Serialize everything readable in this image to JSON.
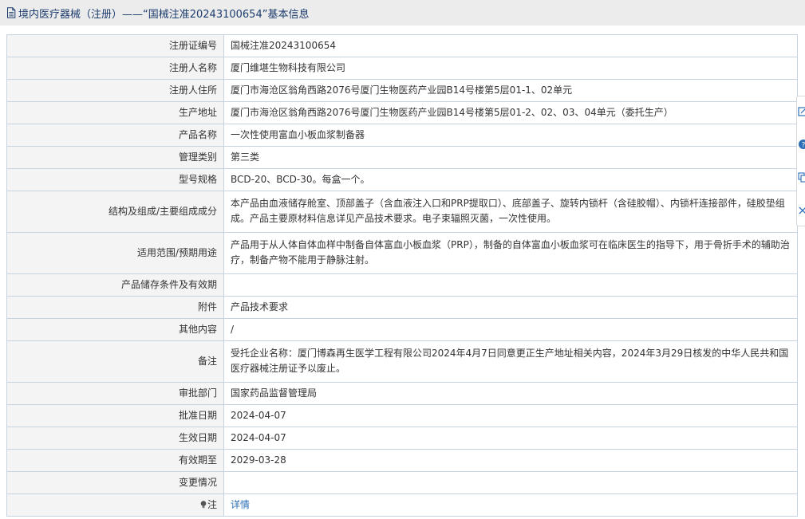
{
  "header": {
    "title": "境内医疗器械（注册）——“国械注准20243100654”基本信息",
    "icon": "document-icon",
    "color": "#1b3c6e"
  },
  "rows": [
    {
      "label": "注册证编号",
      "value": "国械注准20243100654"
    },
    {
      "label": "注册人名称",
      "value": "厦门维堪生物科技有限公司"
    },
    {
      "label": "注册人住所",
      "value": "厦门市海沧区翁角西路2076号厦门生物医药产业园B14号楼第5层01-1、02单元"
    },
    {
      "label": "生产地址",
      "value": "厦门市海沧区翁角西路2076号厦门生物医药产业园B14号楼第5层01-2、02、03、04单元（委托生产）"
    },
    {
      "label": "产品名称",
      "value": "一次性使用富血小板血浆制备器"
    },
    {
      "label": "管理类别",
      "value": "第三类"
    },
    {
      "label": "型号规格",
      "value": "BCD-20、BCD-30。每盒一个。"
    },
    {
      "label": "结构及组成/主要组成成分",
      "value": "本产品由血液储存舱室、顶部盖子（含血液注入口和PRP提取口）、底部盖子、旋转内锁杆（含硅胶帽）、内锁杆连接部件，硅胶垫组成。产品主要原材料信息详见产品技术要求。电子束辐照灭菌，一次性使用。"
    },
    {
      "label": "适用范围/预期用途",
      "value": "产品用于从人体自体血样中制备自体富血小板血浆（PRP），制备的自体富血小板血浆可在临床医生的指导下，用于骨折手术的辅助治疗，制备产物不能用于静脉注射。"
    },
    {
      "label": "产品储存条件及有效期",
      "value": ""
    },
    {
      "label": "附件",
      "value": "产品技术要求"
    },
    {
      "label": "其他内容",
      "value": "/"
    },
    {
      "label": "备注",
      "value": "受托企业名称：厦门博森再生医学工程有限公司2024年4月7日同意更正生产地址相关内容，2024年3月29日核发的中华人民共和国医疗器械注册证予以废止。"
    },
    {
      "label": "审批部门",
      "value": "国家药品监督管理局"
    },
    {
      "label": "批准日期",
      "value": "2024-04-07"
    },
    {
      "label": "生效日期",
      "value": "2024-04-07"
    },
    {
      "label": "有效期至",
      "value": "2029-03-28"
    },
    {
      "label": "变更情况",
      "value": ""
    },
    {
      "label": "注",
      "value": "详情",
      "label_icon": "lightbulb-icon",
      "value_is_link": true
    }
  ],
  "side_toolbar": {
    "tools": [
      {
        "icon": "edit-icon"
      },
      {
        "icon": "help-icon"
      },
      {
        "icon": "copy-icon"
      },
      {
        "icon": "close-icon"
      }
    ]
  },
  "colors": {
    "border": "#c9d3df",
    "label_bg": "#f4f4f4",
    "link": "#2c6fb7",
    "header_bg": "#ececec"
  }
}
